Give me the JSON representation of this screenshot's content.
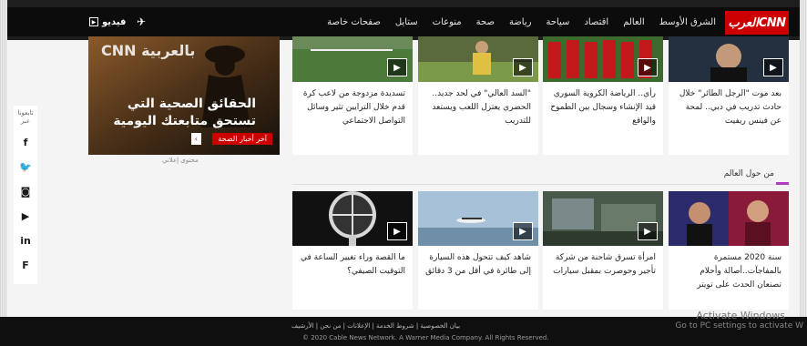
{
  "header": {
    "logo_text": "العربCNN",
    "video_label": "فيديو",
    "nav": [
      "الشرق الأوسط",
      "العالم",
      "اقتصاد",
      "سياحة",
      "رياضة",
      "صحة",
      "منوعات",
      "ستايل",
      "صفحات خاصة"
    ]
  },
  "promo": {
    "brand": "CNN بالعربية",
    "line1": "الحقائق الصحية التي",
    "line2": "تستحق متابعتك اليومية",
    "button": "آخر أخبار الصحة",
    "sponsor": "محتوى إعلاني"
  },
  "top_cards": [
    {
      "text": "بعد موت \"الرجل الطائر\" خلال حادث تدريب في دبي.. لمحة عن فينس ريفيت"
    },
    {
      "text": "رأي.. الرياضة الكروية السوري قيد الإنشاء وسجال بين الطموح والواقع"
    },
    {
      "text": "\"السد العالي\" في لحد جديد.. الحضري يعتزل اللعب ويستعد للتدريب"
    },
    {
      "text": "تسديدة مزدوجة من لاعب كرة قدم خلال الترايين تثير وسائل التواصل الاجتماعي"
    }
  ],
  "section": {
    "title": "من حول العالم"
  },
  "bottom_cards": [
    {
      "text": "سنة 2020 مستمرة بالمفاجآت..أصالة وأحلام تصنعان الحدث على تويتر"
    },
    {
      "text": "امرأة تسرق شاحنة من شركة تأجير وحوصرت بمقبل سيارات"
    },
    {
      "text": "شاهد كيف تتحول هذه السيارة إلى طائرة في أقل من 3 دقائق"
    },
    {
      "text": "ما القصة وراء تغيير الساعة في التوقيت الصيفي؟"
    }
  ],
  "social": {
    "label": "تابعونا عبر"
  },
  "footer": {
    "links": "بيان الخصوصية | شروط الخدمة | الإعلانات | من نحن | الأرشيف",
    "copyright": "© 2020 Cable News Network. A Warner Media Company. All Rights Reserved."
  },
  "os_watermark": {
    "line1": "Activate Windows",
    "line2": "Go to PC settings to activate W"
  }
}
